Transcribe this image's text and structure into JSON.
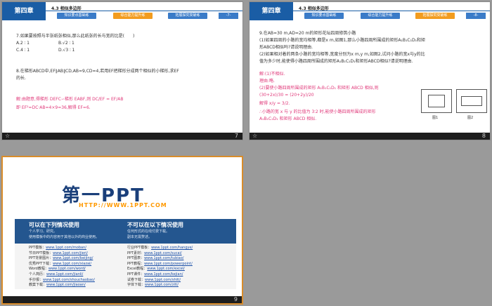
{
  "slide7": {
    "chapter": "第四章",
    "section": "4.3 相似多边形",
    "tabs": [
      "知识要点基础练",
      "综合能力提升练",
      "拓展探究突破练"
    ],
    "page_tag": "-7-",
    "q7": "7.如果要按照与半张纸张相似,那么此纸张的长与宽的比是(　　)",
    "q7_a": "A.2 ∶ 1",
    "q7_b": "B.√2 ∶ 1",
    "q7_c": "C.4 ∶ 1",
    "q7_d": "D.√3 ∶ 1",
    "q8_l1": "8.在梯形ABCD中,EF∥AB∥CD,AB=9,CD=4,若用EF把梯形分成两个相似的小梯形,求EF",
    "q8_l2": "的长.",
    "sol_l1": "解:由题意,得梯形 DEFC∽梯形 EABF,则 DC/EF = EF/AB",
    "sol_l2": "即 EF²=DC·AB=4×9=36,解得 EF=6.",
    "slide_number": "7"
  },
  "slide8": {
    "chapter": "第四章",
    "section": "4.3 相似多边形",
    "tabs": [
      "知识要点基础练",
      "综合能力提升练",
      "拓展探究突破练"
    ],
    "page_tag": "-8-",
    "l1": "9.在AB=30 m,AD=20 m的矩形花坛四周修筑小路",
    "l2": "(1)如果四周的小路的宽均相等,都是x m,如图1,那么小路四周所围成的矩形A₁B₁C₁D₁和矩",
    "l3": "形ABCD相似吗?请说明理由.",
    "l4": "(2)如果相对着的两条小路的宽均相等,宽度分别为x m,y m,如图2,试问小路的宽x与y的比",
    "l5": "值为多少时,能使得小路四周所围成的矩形A₁B₁C₁D₁和矩形ABCD相似?请说明理由.",
    "s1": "解:(1)不相似.",
    "s2": "理由:略.",
    "s3": "(2)要使小路四周所围成的矩形 A₁B₁C₁D₁ 和矩形 ABCD 相似,则",
    "s4": "(30+2x)/30 = (20+2y)/20",
    "s5": "解得 x/y = 3/2.",
    "s6": "∴小路的宽 x 与 y 的比值为 3∶2 时,能使小路四周所围成的矩形",
    "s7": "A₁B₁C₁D₁ 和矩形 ABCD 相似.",
    "fig1": "图1",
    "fig2": "图2",
    "slide_number": "8"
  },
  "slide9": {
    "logo": "第一PPT",
    "url": "HTTP://WWW.1PPT.COM",
    "left_title": "可以在下列情况使用",
    "left_items": [
      "个人学习、研究。",
      "使用模板中的内容用于其他以外的商业使用。"
    ],
    "right_title": "不可以在以下情况使用",
    "right_items": [
      "任何形式的在线付费下载。",
      "副本无需赘述。"
    ],
    "links_left": [
      {
        "label": "PPT模板：",
        "url": "www.1ppt.com/moban/"
      },
      {
        "label": "节日PPT模板：",
        "url": "www.1ppt.com/jieri/"
      },
      {
        "label": "PPT背景图片：",
        "url": "www.1ppt.com/beijing/"
      },
      {
        "label": "优秀PPT下载：",
        "url": "www.1ppt.com/xiazai/"
      },
      {
        "label": "Word教程：",
        "url": "www.1ppt.com/word/"
      },
      {
        "label": "个人简历：",
        "url": "www.1ppt.com/jianli/"
      },
      {
        "label": "手抄报：",
        "url": "www.1ppt.com/shouchaobao/"
      },
      {
        "label": "教案下载：",
        "url": "www.1ppt.com/jiaoan/"
      }
    ],
    "links_right": [
      {
        "label": "行业PPT模板：",
        "url": "www.1ppt.com/hangye/"
      },
      {
        "label": "PPT素材：",
        "url": "www.1ppt.com/sucai/"
      },
      {
        "label": "PPT图表：",
        "url": "www.1ppt.com/tubiao/"
      },
      {
        "label": "PPT教程：",
        "url": "www.1ppt.com/powerpoint/"
      },
      {
        "label": "Excel教程：",
        "url": "www.1ppt.com/excel/"
      },
      {
        "label": "PPT课件：",
        "url": "www.1ppt.com/kejian/"
      },
      {
        "label": "试卷下载：",
        "url": "www.1ppt.com/shiti/"
      },
      {
        "label": "字体下载：",
        "url": "www.1ppt.com/ziti/"
      }
    ],
    "slide_number": "9"
  },
  "colors": {
    "chapter_blue": "#1a5da5",
    "active_tab": "#f29c1f",
    "answer_pink": "#e0397a",
    "logo_blue": "#1a3f7a",
    "logo_orange": "#ff9900"
  },
  "icons": {
    "star": "star-icon"
  }
}
